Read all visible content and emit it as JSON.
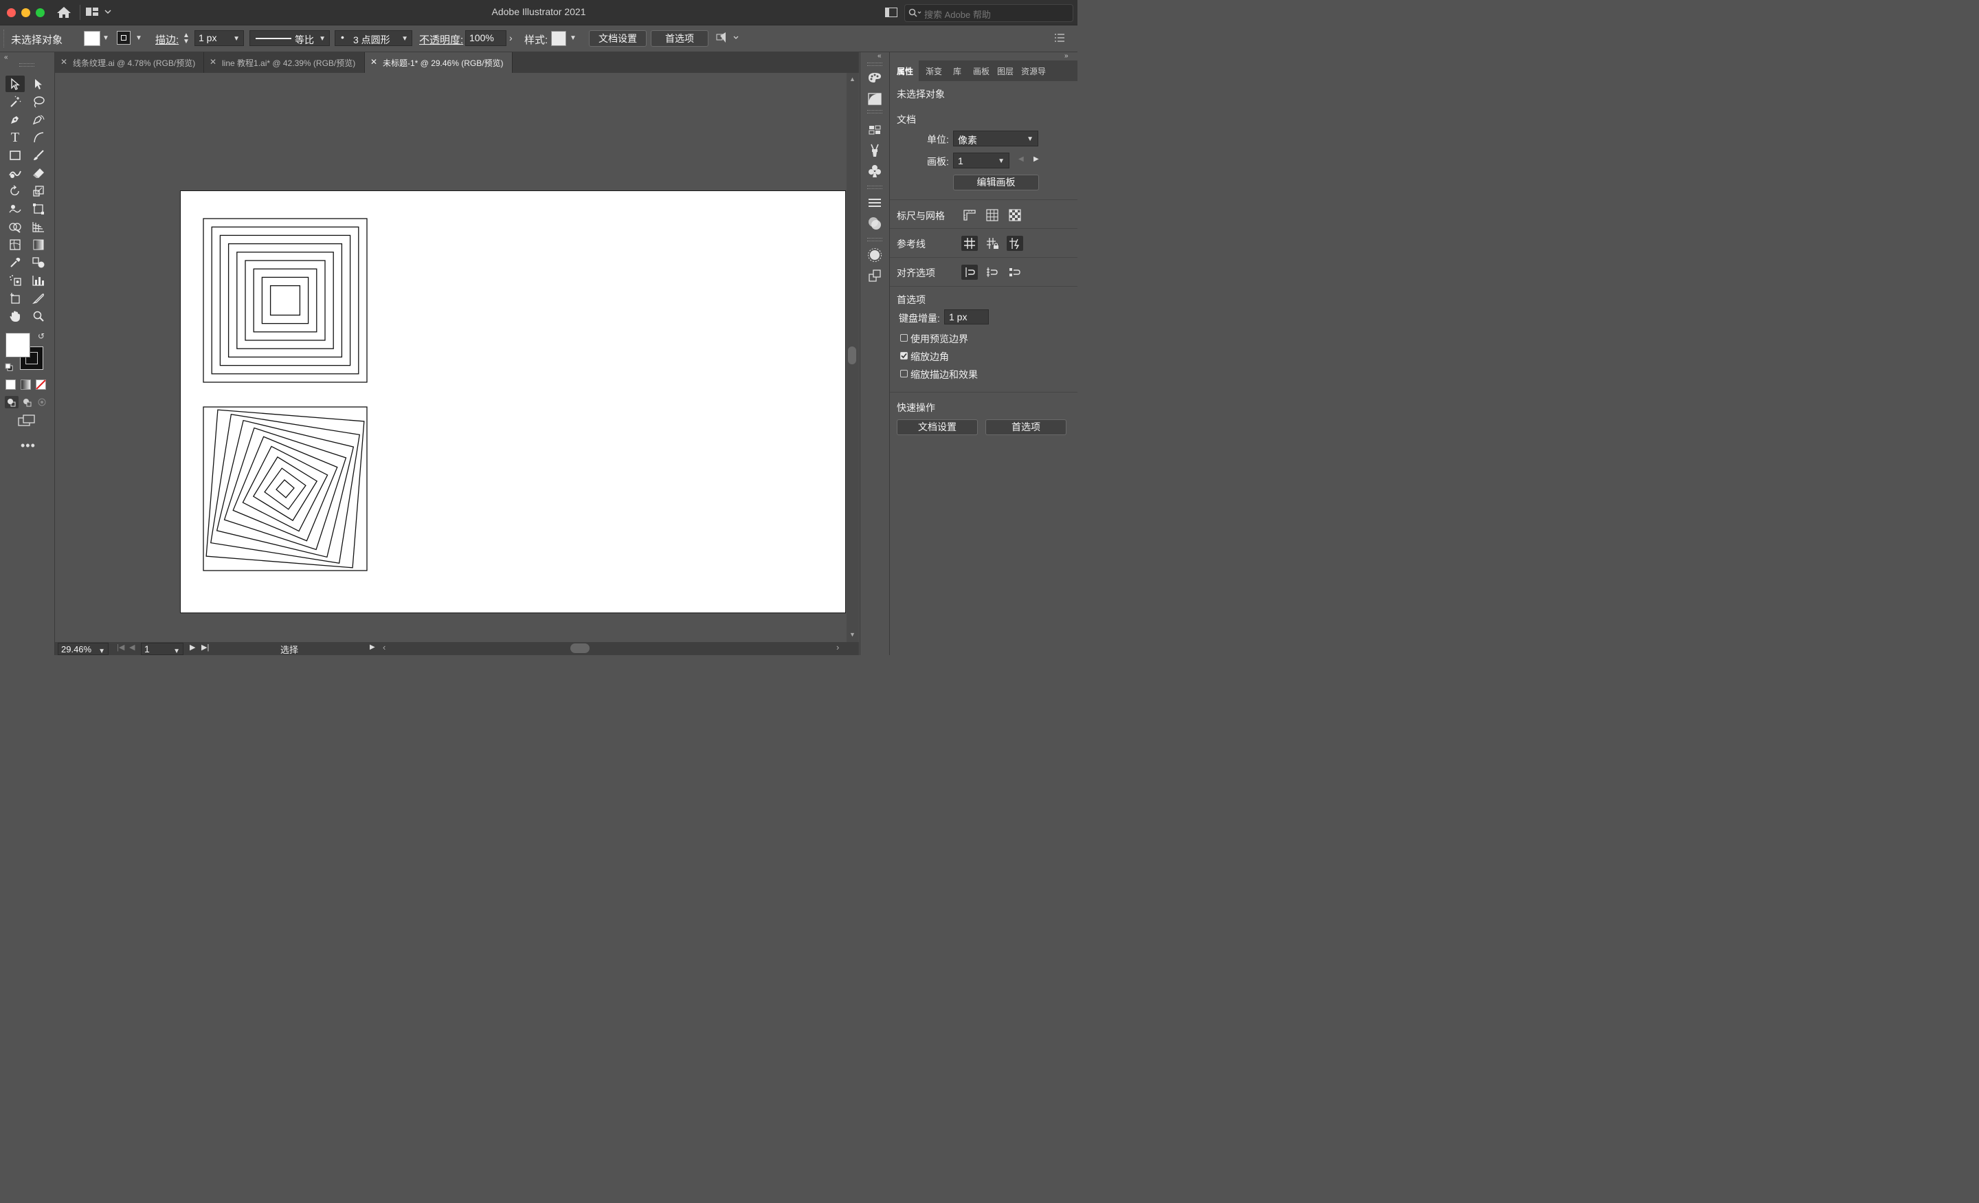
{
  "window": {
    "title": "Adobe Illustrator 2021",
    "search_placeholder": "搜索 Adobe 帮助"
  },
  "control_bar": {
    "selection_state": "未选择对象",
    "stroke_label": "描边:",
    "stroke_weight": "1 px",
    "stroke_profile": "等比",
    "brush": "3 点圆形",
    "opacity_label": "不透明度:",
    "opacity_value": "100%",
    "style_label": "样式:",
    "doc_setup_button": "文档设置",
    "prefs_button": "首选项"
  },
  "tabs": [
    {
      "label": "线条纹理.ai @ 4.78% (RGB/预览)",
      "active": false
    },
    {
      "label": "line 教程1.ai* @ 42.39% (RGB/预览)",
      "active": false
    },
    {
      "label": "未标题-1* @ 29.46% (RGB/预览)",
      "active": true
    }
  ],
  "tools": [
    "selection-tool",
    "direct-selection-tool",
    "magic-wand-tool",
    "lasso-tool",
    "pen-tool",
    "curvature-tool",
    "type-tool",
    "arc-tool",
    "rectangle-tool",
    "paintbrush-tool",
    "shaper-tool",
    "eraser-tool",
    "rotate-tool",
    "scale-tool",
    "warp-tool",
    "free-transform-tool",
    "shape-builder-tool",
    "perspective-grid-tool",
    "mesh-tool",
    "gradient-tool",
    "eyedropper-tool",
    "blend-tool",
    "symbol-sprayer-tool",
    "column-graph-tool",
    "artboard-tool",
    "slice-tool",
    "hand-tool",
    "zoom-tool"
  ],
  "status_bar": {
    "zoom": "29.46%",
    "artboard_number": "1",
    "tool_name": "选择"
  },
  "properties_panel": {
    "tabs": [
      "属性",
      "渐变",
      "库",
      "画板",
      "图层",
      "资源导"
    ],
    "active_tab": "属性",
    "selection_state": "未选择对象",
    "document_heading": "文档",
    "units_label": "单位:",
    "units_value": "像素",
    "artboard_label": "画板:",
    "artboard_value": "1",
    "edit_artboards_button": "编辑画板",
    "rulers_grids_label": "标尺与网格",
    "guides_label": "参考线",
    "snap_options_label": "对齐选项",
    "preferences_heading": "首选项",
    "keyboard_increment_label": "键盘增量:",
    "keyboard_increment_value": "1 px",
    "checkboxes": [
      {
        "label": "使用预览边界",
        "checked": false
      },
      {
        "label": "缩放边角",
        "checked": true
      },
      {
        "label": "缩放描边和效果",
        "checked": false
      }
    ],
    "quick_actions_heading": "快速操作",
    "doc_setup_button": "文档设置",
    "prefs_button": "首选项"
  },
  "colors": {
    "accent_red": "#ff5f57",
    "accent_yellow": "#febc2e",
    "accent_green": "#28c840",
    "artboard": "#ffffff",
    "chrome": "#535353"
  }
}
